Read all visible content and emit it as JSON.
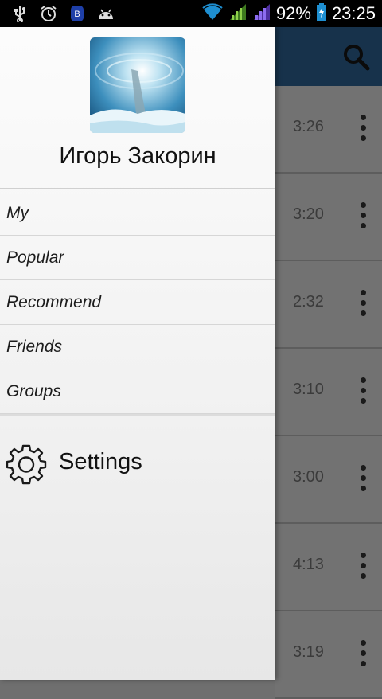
{
  "status_bar": {
    "icons": [
      "usb-icon",
      "alarm-icon",
      "bluetooth-icon",
      "android-icon",
      "wifi-icon",
      "signal-icon",
      "signal-icon-2",
      "battery-icon"
    ],
    "battery": "92%",
    "time": "23:25"
  },
  "drawer": {
    "user_name": "Игорь Закорин",
    "menu": [
      {
        "label": "My"
      },
      {
        "label": "Popular"
      },
      {
        "label": "Recommend"
      },
      {
        "label": "Friends"
      },
      {
        "label": "Groups"
      }
    ],
    "settings_label": "Settings"
  },
  "list": {
    "durations": [
      "3:26",
      "3:20",
      "2:32",
      "3:10",
      "3:00",
      "4:13",
      "3:19"
    ]
  },
  "colors": {
    "appbar": "#17324b",
    "dim_overlay": "#727272"
  }
}
